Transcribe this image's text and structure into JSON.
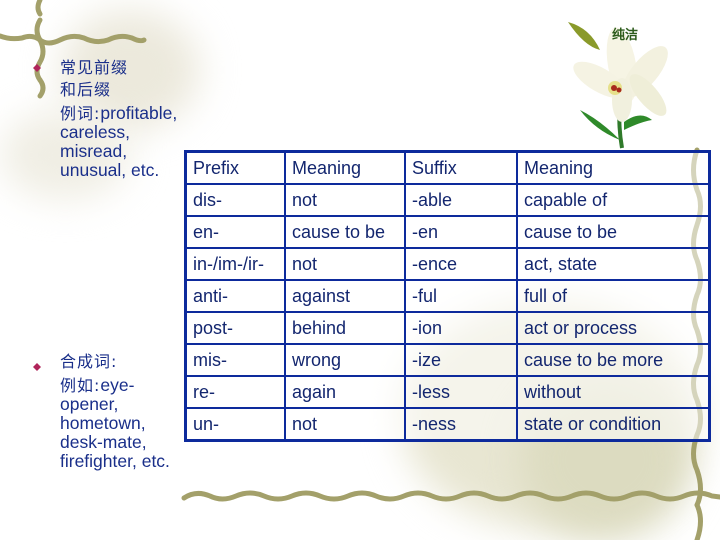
{
  "decoration": {
    "lily_caption": "纯洁"
  },
  "bullets": [
    {
      "lines_cn": [
        "常见前缀",
        "和后缀"
      ],
      "example_prefix": "例词:",
      "example_lines": [
        "profitable,",
        "careless,",
        "misread,",
        "unusual, etc."
      ]
    },
    {
      "lines_cn": [
        "合成词:"
      ],
      "example_prefix": "例如:",
      "example_lines": [
        "eye-",
        "opener,",
        "hometown,",
        "desk-mate,",
        "firefighter, etc."
      ]
    }
  ],
  "table": {
    "headers": [
      "Prefix",
      "Meaning",
      "Suffix",
      "Meaning"
    ],
    "rows": [
      [
        "dis-",
        "not",
        "-able",
        "capable of"
      ],
      [
        "en-",
        "cause to be",
        "-en",
        "cause to be"
      ],
      [
        "in-/im-/ir-",
        "not",
        "-ence",
        "act, state"
      ],
      [
        "anti-",
        "against",
        "-ful",
        "full of"
      ],
      [
        "post-",
        "behind",
        "-ion",
        "act or process"
      ],
      [
        "mis-",
        "wrong",
        "-ize",
        "cause to be more"
      ],
      [
        "re-",
        "again",
        "-less",
        "without"
      ],
      [
        "un-",
        "not",
        "-ness",
        "state or condition"
      ]
    ]
  },
  "colors": {
    "text": "#1a2f8a",
    "table_border": "#0d2a9c",
    "vine": "#a3a06a",
    "bullet": "#b0245a"
  }
}
